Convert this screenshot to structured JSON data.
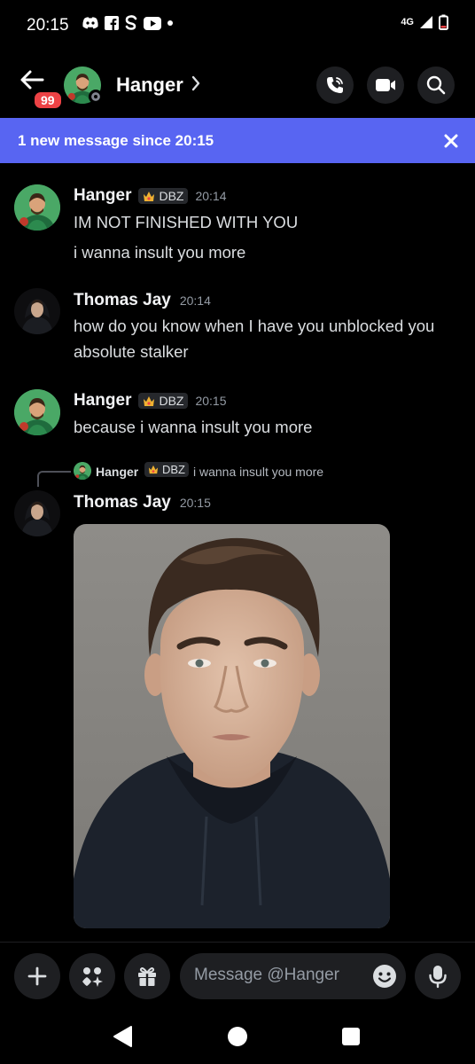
{
  "status_bar": {
    "time": "20:15",
    "notification_icons": [
      "discord-icon",
      "facebook-icon",
      "skype-icon",
      "youtube-icon",
      "dot-icon"
    ],
    "network": "4G",
    "battery": "low"
  },
  "header": {
    "unread_badge": "99",
    "name": "Hanger",
    "actions": [
      "voice-call-icon",
      "video-call-icon",
      "search-icon"
    ]
  },
  "banner": {
    "text": "1 new message since 20:15"
  },
  "messages": [
    {
      "user": "Hanger",
      "tag": "DBZ",
      "time": "20:14",
      "lines": [
        "IM NOT FINISHED WITH YOU",
        "i wanna insult you more"
      ]
    },
    {
      "user": "Thomas Jay",
      "time": "20:14",
      "lines": [
        "how do you know when I have you unblocked you absolute stalker"
      ]
    },
    {
      "user": "Hanger",
      "tag": "DBZ",
      "time": "20:15",
      "lines": [
        "because i wanna insult you more"
      ]
    },
    {
      "reply_to": {
        "user": "Hanger",
        "tag": "DBZ",
        "text": "i wanna insult you more"
      },
      "user": "Thomas Jay",
      "time": "20:15",
      "attachment": "photo"
    }
  ],
  "composer": {
    "placeholder": "Message @Hanger",
    "buttons": [
      "plus-icon",
      "apps-icon",
      "gift-icon",
      "emoji-icon",
      "microphone-icon"
    ]
  },
  "colors": {
    "background": "#000000",
    "banner": "#5865f2",
    "badge": "#ed4245",
    "surface": "#1e1f22",
    "tag_crown": "#f0b232"
  }
}
